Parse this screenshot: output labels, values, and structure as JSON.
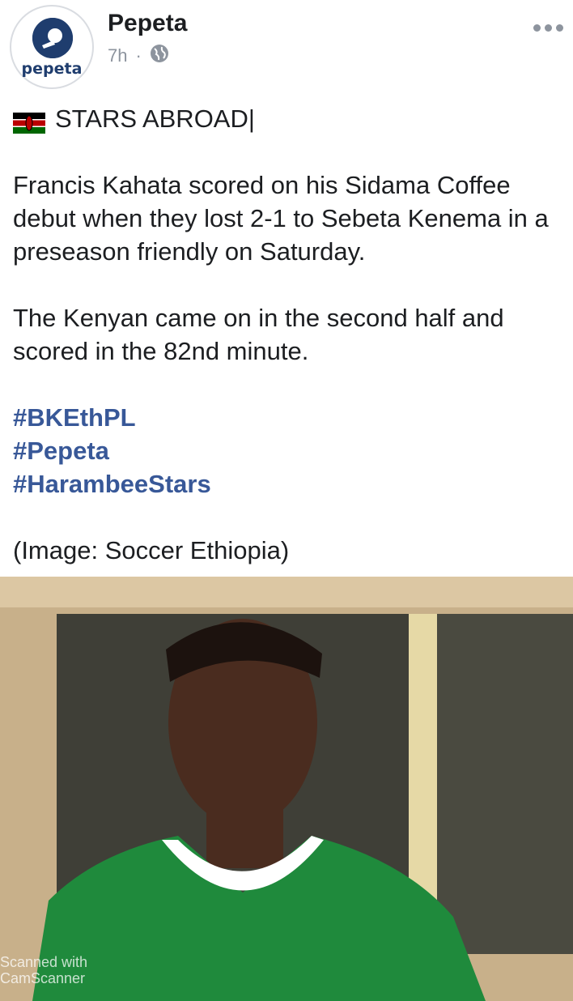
{
  "page": {
    "name": "Pepeta",
    "time": "7h",
    "avatar_text": "pepeta"
  },
  "post": {
    "headline": "STARS ABROAD|",
    "paragraphs": [
      "Francis Kahata scored on his Sidama Coffee debut when they lost 2-1 to Sebeta Kenema in a preseason friendly on Saturday.",
      "The Kenyan came on in the second half and scored in the 82nd minute."
    ],
    "hashtags": [
      "#BKEthPL",
      "#Pepeta",
      "#HarambeeStars"
    ],
    "credit": "(Image: Soccer Ethiopia)"
  },
  "icons": {
    "privacy": "globe-icon",
    "menu": "more-options-icon",
    "flag": "kenya-flag-icon"
  },
  "watermark": {
    "line1": "Scanned with",
    "line2": "CamScanner"
  },
  "colors": {
    "hashtag": "#385898",
    "meta": "#8d949e",
    "brand": "#1f3d6e"
  }
}
